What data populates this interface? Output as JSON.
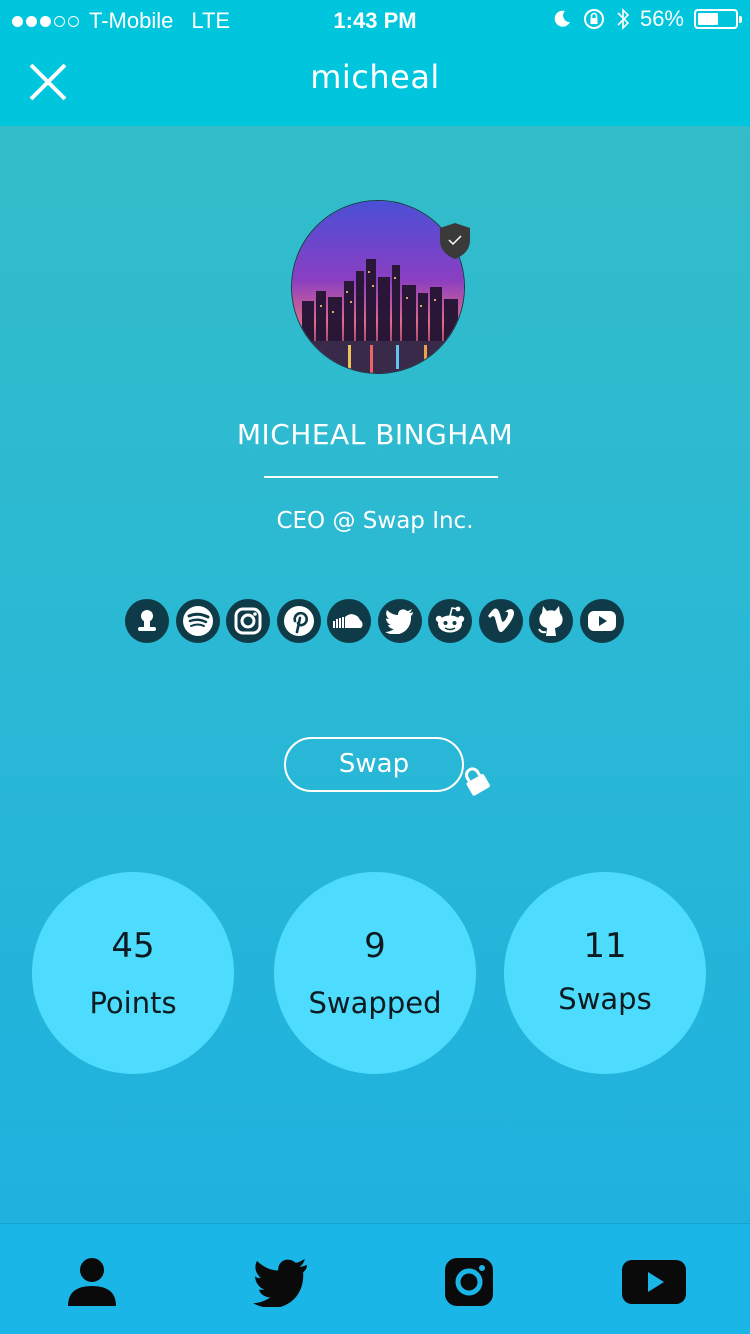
{
  "status_bar": {
    "carrier": "T-Mobile",
    "network": "LTE",
    "time": "1:43 PM",
    "battery": "56%",
    "battery_level": 0.56
  },
  "nav": {
    "title": "micheal"
  },
  "profile": {
    "name": "MICHEAL BINGHAM",
    "title": "CEO @ Swap Inc."
  },
  "social_icons": [
    "contact-icon",
    "spotify-icon",
    "instagram-icon",
    "pinterest-icon",
    "soundcloud-icon",
    "twitter-icon",
    "reddit-icon",
    "vimeo-icon",
    "github-icon",
    "youtube-icon"
  ],
  "swap_button": {
    "label": "Swap"
  },
  "stats": [
    {
      "value": "45",
      "label": "Points"
    },
    {
      "value": "9",
      "label": "Swapped"
    },
    {
      "value": "11",
      "label": "Swaps"
    }
  ],
  "tab_bar": {
    "items": [
      "profile-icon",
      "twitter-icon",
      "instagram-icon",
      "youtube-icon"
    ]
  },
  "colors": {
    "header": "#00c6dd",
    "stat_circle": "#4ddcfd",
    "social_icon_bg": "#0e3b47",
    "tab_bar": "#19b6e7"
  }
}
